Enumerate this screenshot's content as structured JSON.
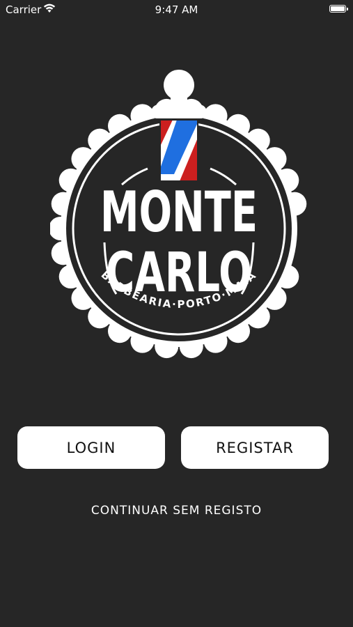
{
  "status_bar": {
    "carrier": "Carrier",
    "time": "9:47 AM",
    "icons": [
      "wifi-icon",
      "battery-icon"
    ]
  },
  "logo": {
    "line1": "MONTE",
    "line2": "CARLO",
    "tagline": "BARBEARIA·PORTO·MAIA",
    "colors": {
      "red": "#cc1f1f",
      "blue": "#1f6fe0",
      "white": "#ffffff",
      "dark": "#262626"
    }
  },
  "actions": {
    "login_label": "LOGIN",
    "register_label": "REGISTAR",
    "guest_label": "CONTINUAR SEM REGISTO"
  },
  "theme": {
    "background": "#262626",
    "button_bg": "#ffffff",
    "text_light": "#ffffff"
  }
}
